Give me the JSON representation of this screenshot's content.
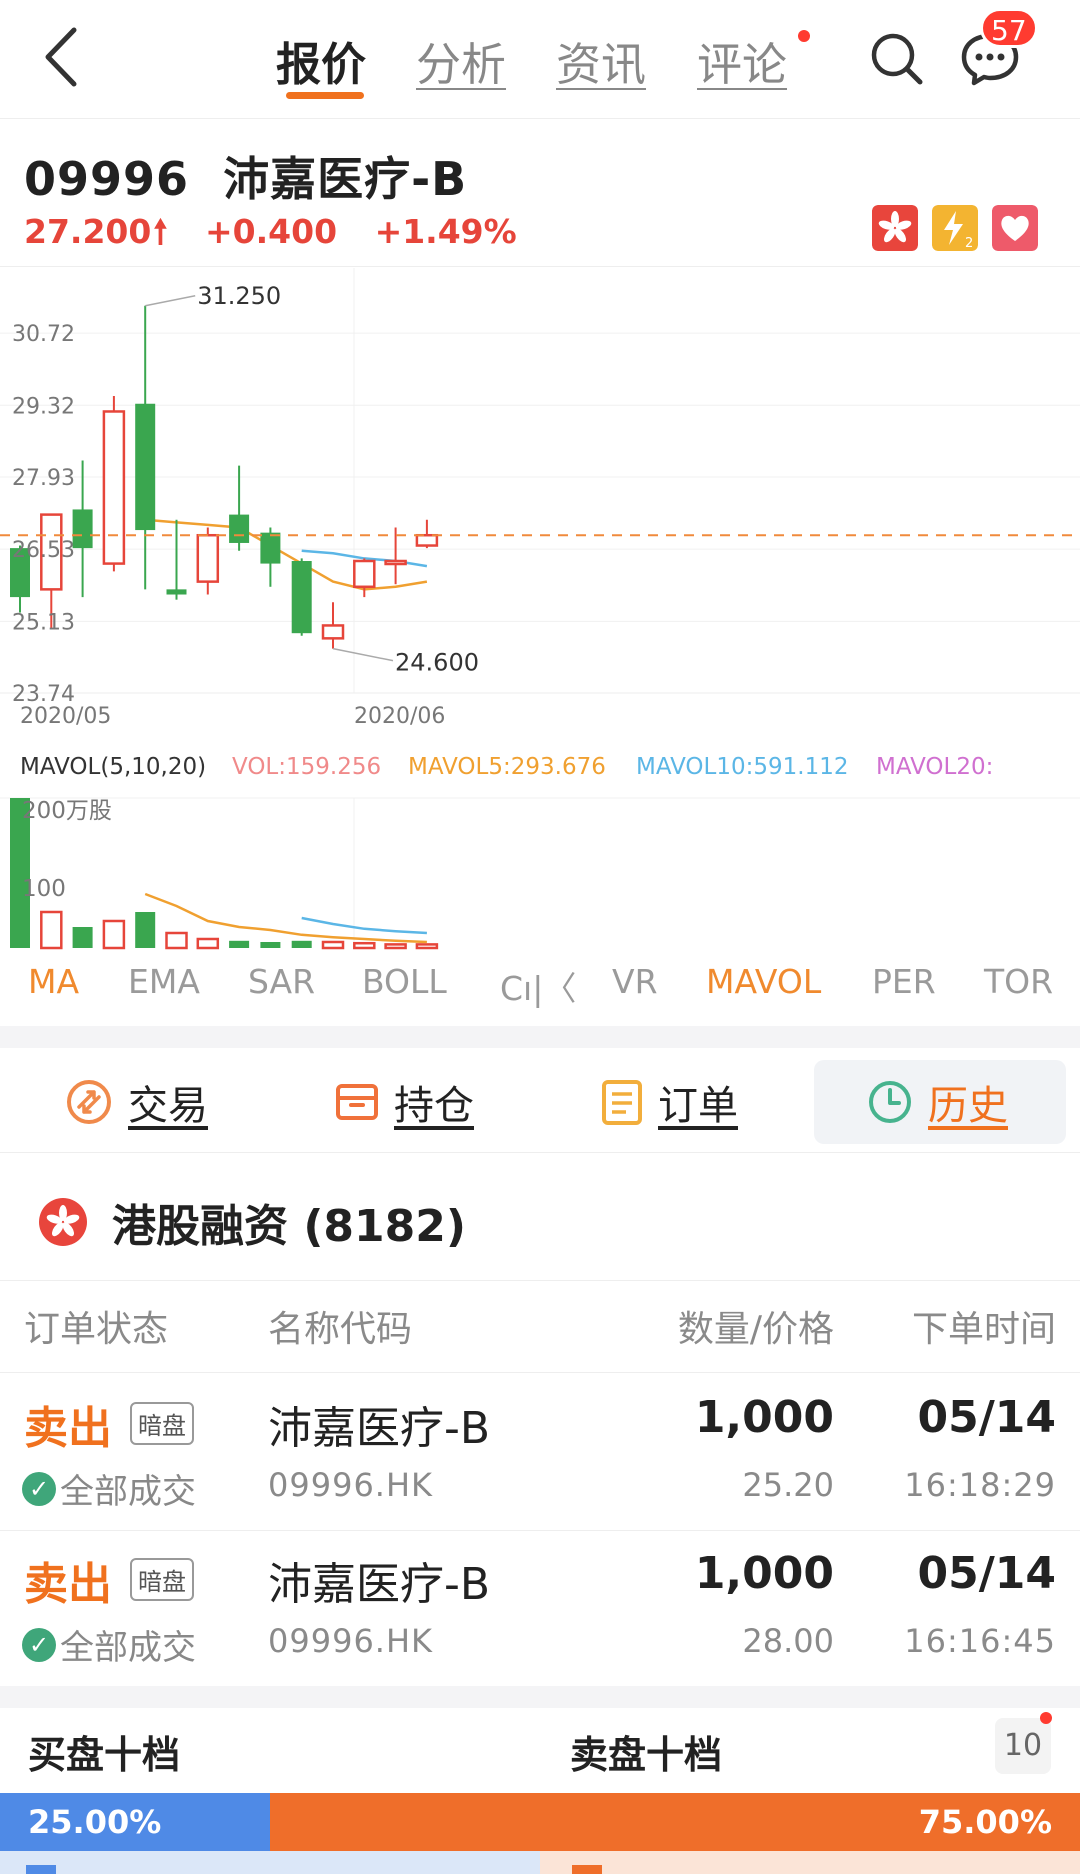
{
  "nav": {
    "tabs": [
      "报价",
      "分析",
      "资讯",
      "评论"
    ],
    "message_badge": "57"
  },
  "stock": {
    "code": "09996",
    "name": "沛嘉医疗-B",
    "price": "27.200",
    "change": "+0.400",
    "change_pct": "+1.49%",
    "up_color": "#e6453a",
    "down_color": "#3aa64f"
  },
  "chart_data": [
    {
      "type": "candlestick",
      "y_ticks": [
        "30.72",
        "29.32",
        "27.93",
        "26.53",
        "25.13",
        "23.74"
      ],
      "ylim": [
        23.74,
        31.75
      ],
      "x_ticks": [
        "2020/05",
        "2020/06"
      ],
      "annotations": {
        "high": "31.250",
        "low": "24.600"
      },
      "reference_price": 26.8,
      "candles": [
        {
          "o": 26.55,
          "h": 26.6,
          "c": 25.6,
          "l": 25.3
        },
        {
          "o": 25.75,
          "h": 27.2,
          "c": 27.2,
          "l": 25.0
        },
        {
          "o": 27.3,
          "h": 28.25,
          "c": 26.55,
          "l": 25.6
        },
        {
          "o": 26.25,
          "h": 29.5,
          "c": 29.2,
          "l": 26.1
        },
        {
          "o": 29.35,
          "h": 31.25,
          "c": 26.9,
          "l": 25.75
        },
        {
          "o": 25.75,
          "h": 27.1,
          "c": 25.65,
          "l": 25.55
        },
        {
          "o": 25.9,
          "h": 26.95,
          "c": 26.8,
          "l": 25.65
        },
        {
          "o": 27.2,
          "h": 28.15,
          "c": 26.65,
          "l": 26.5
        },
        {
          "o": 26.85,
          "h": 26.95,
          "c": 26.25,
          "l": 25.8
        },
        {
          "o": 26.3,
          "h": 26.35,
          "c": 24.9,
          "l": 24.85
        },
        {
          "o": 24.8,
          "h": 25.5,
          "c": 25.05,
          "l": 24.6
        },
        {
          "o": 25.8,
          "h": 26.35,
          "c": 26.3,
          "l": 25.6
        },
        {
          "o": 26.3,
          "h": 26.95,
          "c": 26.3,
          "l": 25.85
        },
        {
          "o": 26.6,
          "h": 27.1,
          "c": 26.8,
          "l": 26.55
        }
      ],
      "ma_lines": [
        {
          "name": "MA5",
          "color": "#f0a030",
          "values": [
            null,
            null,
            null,
            null,
            27.1,
            27.05,
            27.0,
            26.95,
            26.6,
            26.25,
            25.9,
            25.75,
            25.8,
            25.9
          ]
        },
        {
          "name": "MA10",
          "color": "#5bb6e6",
          "values": [
            null,
            null,
            null,
            null,
            null,
            null,
            null,
            null,
            null,
            26.5,
            26.45,
            26.35,
            26.3,
            26.2
          ]
        }
      ]
    },
    {
      "type": "bar",
      "title": "MAVOL(5,10,20)",
      "legend": [
        {
          "label": "VOL:159.256",
          "color": "#f08a8a"
        },
        {
          "label": "MAVOL5:293.676",
          "color": "#f0a030"
        },
        {
          "label": "MAVOL10:591.112",
          "color": "#5bb6e6"
        },
        {
          "label": "MAVOL20:",
          "color": "#d070d0"
        }
      ],
      "y_ticks": [
        "200万股",
        "100"
      ],
      "ylim": [
        0,
        250
      ],
      "volumes": [
        250,
        60,
        35,
        45,
        60,
        25,
        15,
        12,
        10,
        12,
        10,
        8,
        6,
        6
      ],
      "vol_up": [
        false,
        true,
        false,
        true,
        false,
        true,
        true,
        false,
        false,
        false,
        true,
        true,
        true,
        true
      ],
      "mavol5": [
        null,
        null,
        null,
        null,
        90,
        70,
        45,
        35,
        30,
        22,
        18,
        15,
        12,
        10
      ],
      "mavol10": [
        null,
        null,
        null,
        null,
        null,
        null,
        null,
        null,
        null,
        50,
        40,
        32,
        28,
        25
      ]
    }
  ],
  "indicator_tabs": [
    "MA",
    "EMA",
    "SAR",
    "BOLL",
    "Cı|〈",
    "VR",
    "MAVOL",
    "PER",
    "TOR"
  ],
  "actions": [
    {
      "label": "交易"
    },
    {
      "label": "持仓"
    },
    {
      "label": "订单"
    },
    {
      "label": "历史"
    }
  ],
  "account": {
    "title": "港股融资 (8182)"
  },
  "orders": {
    "headers": [
      "订单状态",
      "名称代码",
      "数量/价格",
      "下单时间"
    ],
    "rows": [
      {
        "side": "卖出",
        "tag": "暗盘",
        "status": "全部成交",
        "name": "沛嘉医疗-B",
        "code": "09996.HK",
        "qty": "1,000",
        "price": "25.20",
        "date": "05/14",
        "time": "16:18:29"
      },
      {
        "side": "卖出",
        "tag": "暗盘",
        "status": "全部成交",
        "name": "沛嘉医疗-B",
        "code": "09996.HK",
        "qty": "1,000",
        "price": "28.00",
        "date": "05/14",
        "time": "16:16:45"
      }
    ]
  },
  "orderbook": {
    "buy_label": "买盘十档",
    "sell_label": "卖盘十档",
    "level": "10",
    "buy_pct": "25.00%",
    "sell_pct": "75.00%",
    "buy_ratio": 0.25
  }
}
